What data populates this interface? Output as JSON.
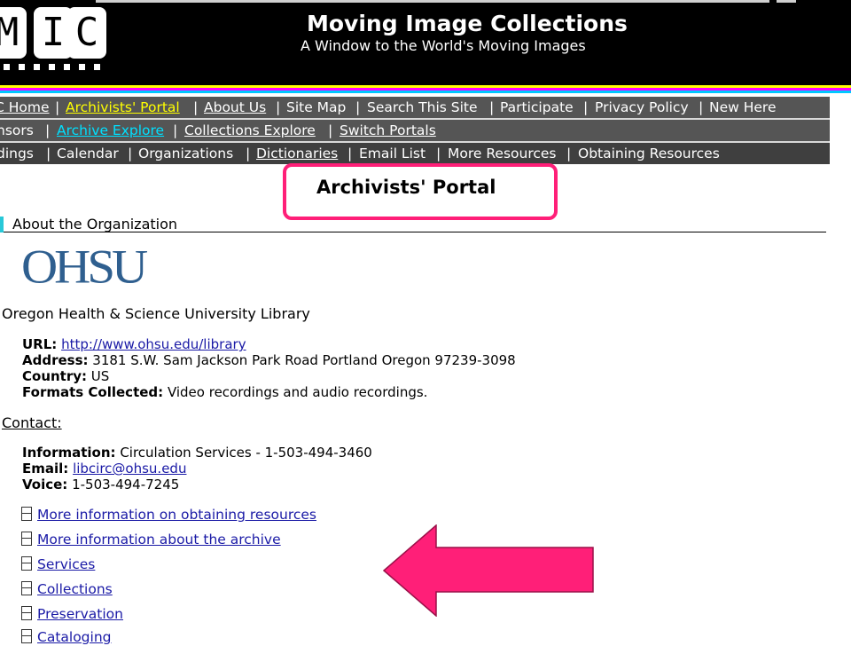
{
  "header": {
    "logo_letters": [
      "M",
      "I",
      "C"
    ],
    "title": "Moving Image Collections",
    "subtitle": "A Window to the World's Moving Images"
  },
  "nav": {
    "row1": [
      "C Home",
      "Archivists' Portal",
      "About Us",
      "Site Map",
      "Search This Site",
      "Participate",
      "Privacy Policy",
      "New Here"
    ],
    "row2": [
      "nsors",
      "Archive Explore",
      "Collections Explore",
      "Switch Portals"
    ],
    "row3": [
      "dings",
      "Calendar",
      "Organizations",
      "Dictionaries",
      "Email List",
      "More Resources",
      "Obtaining Resources"
    ],
    "separator": "|"
  },
  "page": {
    "portal_title": "Archivists' Portal",
    "section_heading": "About the Organization"
  },
  "org": {
    "logo_text": "OHSU",
    "name": "Oregon Health & Science University Library",
    "url_label": "URL:",
    "url": "http://www.ohsu.edu/library",
    "address_label": "Address:",
    "address": "3181 S.W. Sam Jackson Park Road Portland Oregon 97239-3098",
    "country_label": "Country:",
    "country": "US",
    "formats_label": "Formats Collected:",
    "formats": "Video recordings and audio recordings."
  },
  "contact": {
    "heading": "Contact:",
    "info_label": "Information:",
    "info": "Circulation Services - 1-503-494-3460",
    "email_label": "Email:",
    "email": "libcirc@ohsu.edu",
    "voice_label": "Voice:",
    "voice": "1-503-494-7245"
  },
  "resources": [
    "More information on obtaining resources",
    "More information about the archive",
    "Services",
    "Collections",
    "Preservation",
    "Cataloging"
  ],
  "colors": {
    "header_bg": "#000000",
    "nav_bg": "#555555",
    "nav_highlight": "#ffff00",
    "nav_link_cyan": "#00e0ff",
    "annotation": "#ff1f78",
    "link": "#1a1aa6",
    "ohsu_blue": "#2f5f8f"
  }
}
